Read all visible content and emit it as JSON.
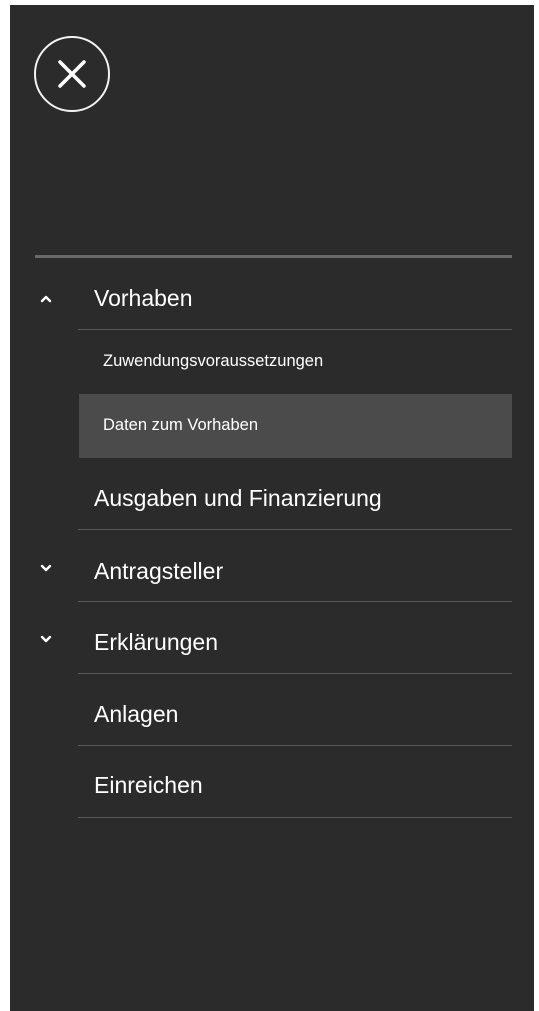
{
  "menu": {
    "close_icon": "close-icon",
    "items": [
      {
        "label": "Vorhaben",
        "chevron": "chevron-up-icon",
        "expanded": true
      },
      {
        "label": "Ausgaben und Finanzierung"
      },
      {
        "label": "Antragsteller",
        "chevron": "chevron-down-icon",
        "expanded": false
      },
      {
        "label": "Erklärungen",
        "chevron": "chevron-down-icon",
        "expanded": false
      },
      {
        "label": "Anlagen"
      },
      {
        "label": "Einreichen"
      }
    ],
    "subitems": [
      {
        "label": "Zuwendungsvoraussetzungen",
        "active": false
      },
      {
        "label": "Daten zum Vorhaben",
        "active": true
      }
    ]
  },
  "colors": {
    "panel_background": "#2b2b2b",
    "active_subitem_background": "#4b4b4b",
    "divider": "#5a5a5a",
    "text": "#ffffff"
  }
}
